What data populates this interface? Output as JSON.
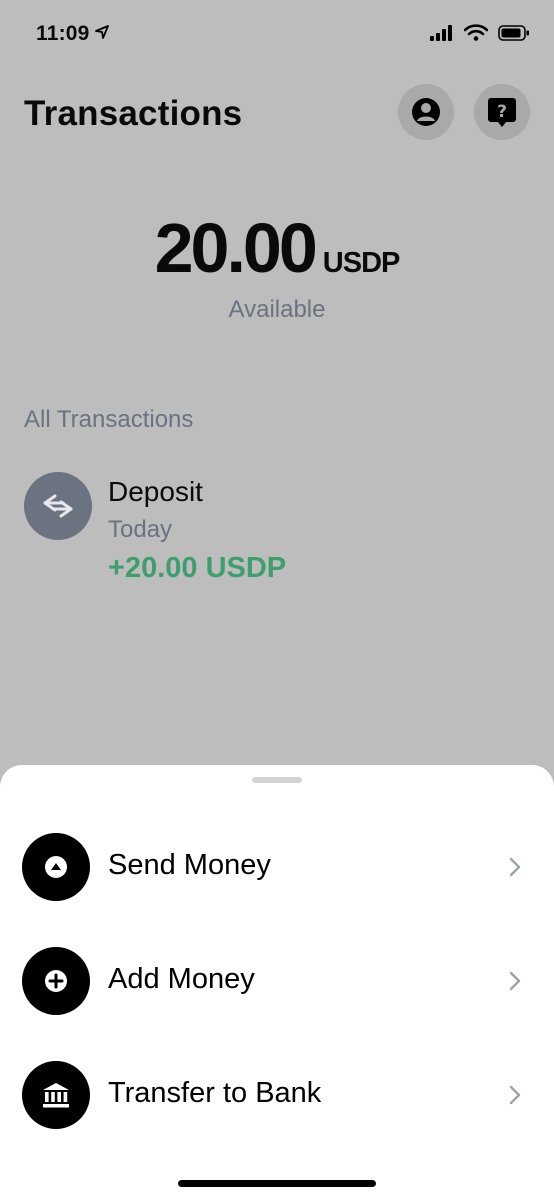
{
  "status": {
    "time": "11:09"
  },
  "header": {
    "title": "Transactions"
  },
  "balance": {
    "amount": "20.00",
    "currency": "USDP",
    "label": "Available"
  },
  "transactions": {
    "section_title": "All Transactions",
    "items": [
      {
        "title": "Deposit",
        "date": "Today",
        "amount": "+20.00 USDP"
      }
    ]
  },
  "actions": [
    {
      "label": "Send Money",
      "icon": "arrow-up-icon"
    },
    {
      "label": "Add Money",
      "icon": "plus-icon"
    },
    {
      "label": "Transfer to Bank",
      "icon": "bank-icon"
    }
  ],
  "colors": {
    "accent_green": "#3f9e6e",
    "overlay_gray": "#bdbdbd",
    "muted_text": "#6b7280"
  }
}
